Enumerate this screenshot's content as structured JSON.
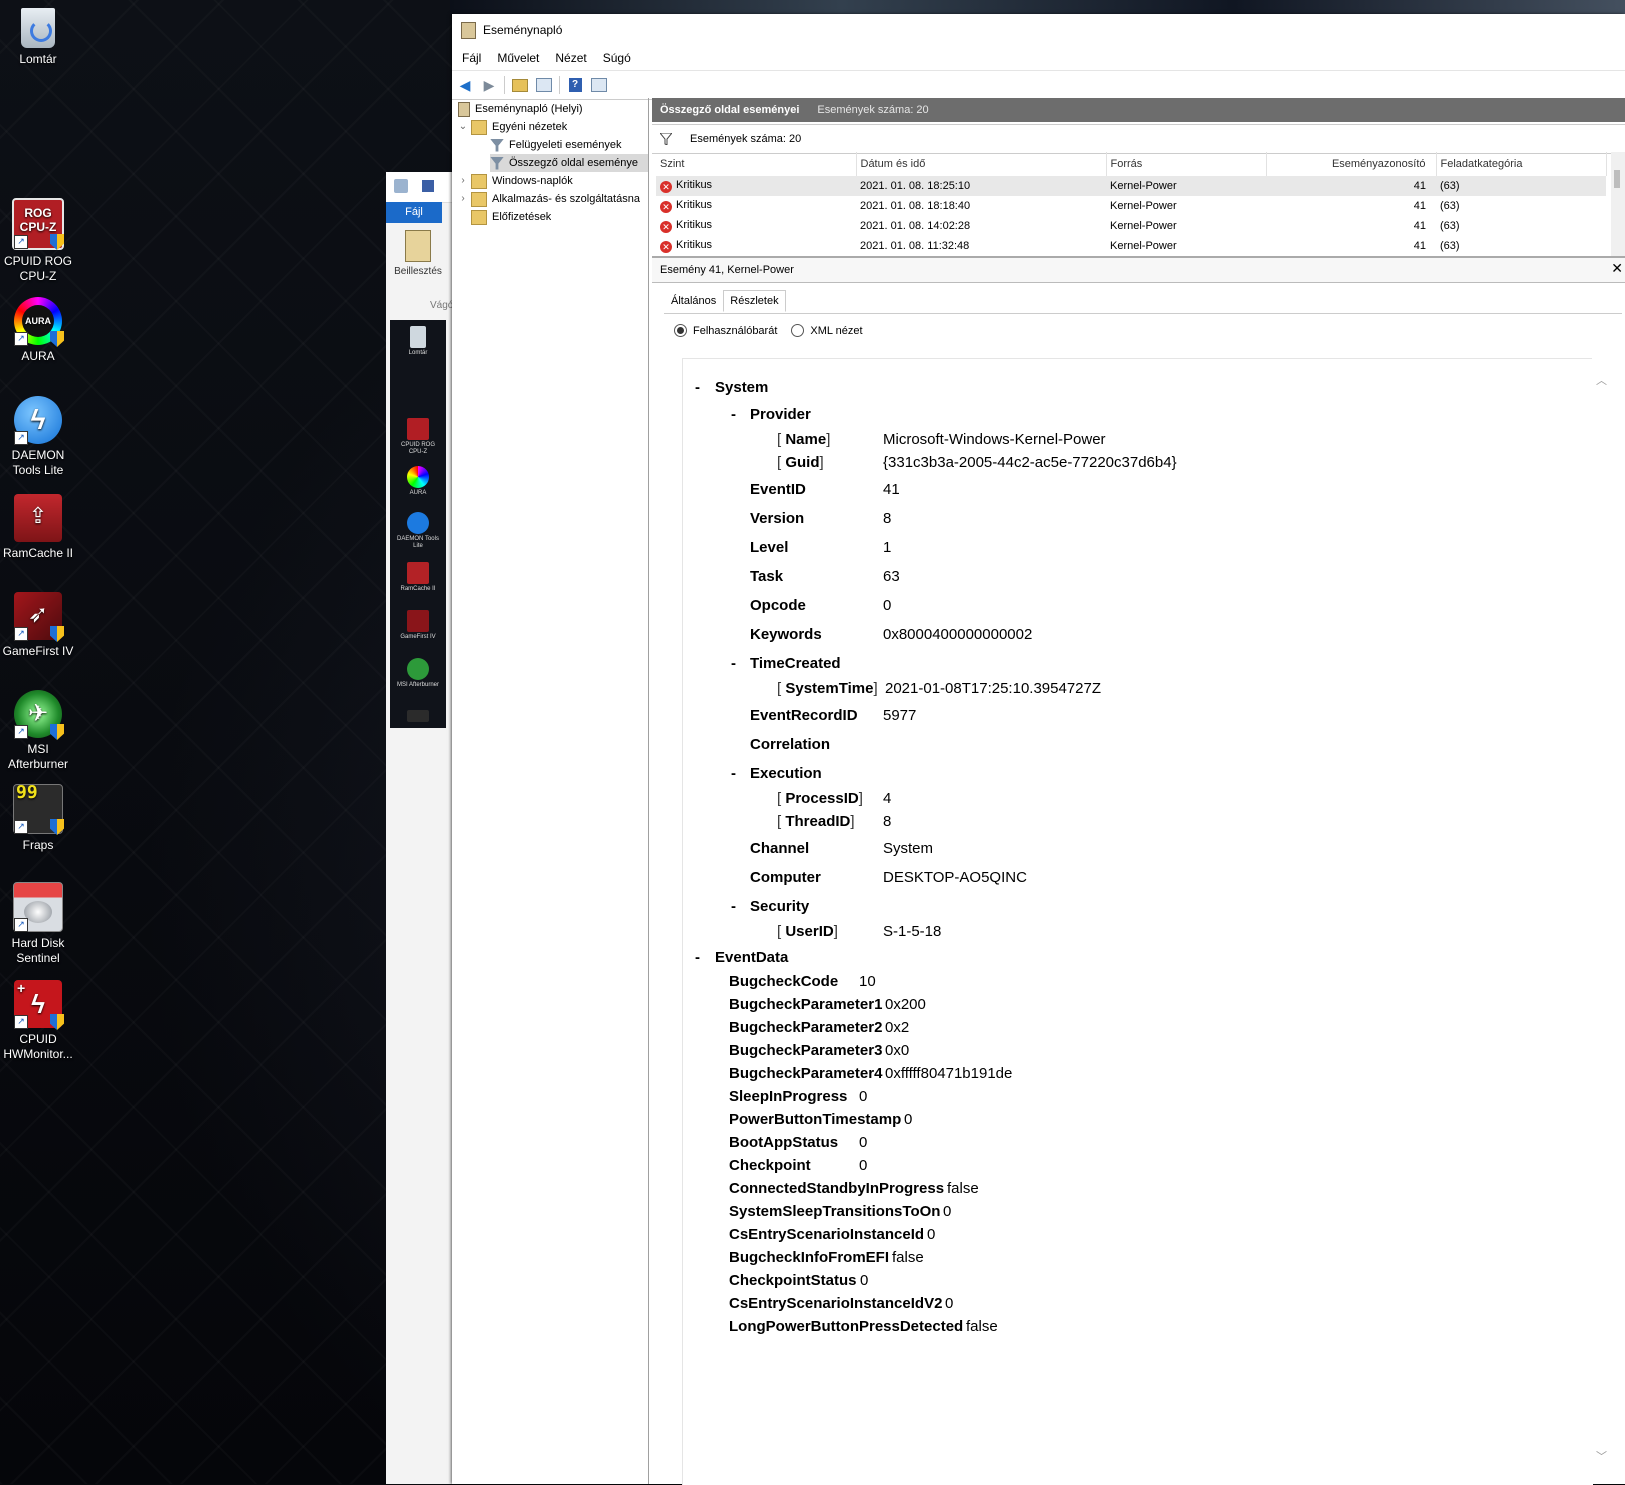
{
  "desktop": {
    "icons": [
      {
        "label": "Lomtár",
        "icon": "recycle-bin-icon"
      },
      {
        "label": "CPUID ROG CPU-Z",
        "icon": "rog-cpuz-icon"
      },
      {
        "label": "AURA",
        "icon": "aura-icon"
      },
      {
        "label": "DAEMON Tools Lite",
        "icon": "daemon-tools-icon"
      },
      {
        "label": "RamCache II",
        "icon": "ramcache-icon"
      },
      {
        "label": "GameFirst IV",
        "icon": "gamefirst-icon"
      },
      {
        "label": "MSI Afterburner",
        "icon": "msi-afterburner-icon"
      },
      {
        "label": "Fraps",
        "icon": "fraps-icon"
      },
      {
        "label": "Hard Disk Sentinel",
        "icon": "hard-disk-sentinel-icon"
      },
      {
        "label": "CPUID HWMonitor...",
        "icon": "hwmonitor-icon"
      }
    ]
  },
  "wordpad": {
    "tab_file": "Fájl",
    "paste_label": "Beillesztés",
    "group_label": "Vágó",
    "preview_icons": [
      "Lomtár",
      "CPUID ROG CPU-Z",
      "AURA",
      "DAEMON Tools Lite",
      "RamCache II",
      "GameFirst IV",
      "MSI Afterburner"
    ]
  },
  "window": {
    "title": "Eseménynapló",
    "menu": [
      "Fájl",
      "Művelet",
      "Nézet",
      "Súgó"
    ]
  },
  "tree": {
    "root": "Eseménynapló (Helyi)",
    "custom_views": "Egyéni nézetek",
    "admin_events": "Felügyeleti események",
    "summary_events": "Összegző oldal eseménye",
    "windows_logs": "Windows-naplók",
    "app_logs": "Alkalmazás- és szolgáltatásna",
    "subscriptions": "Előfizetések"
  },
  "list": {
    "header_title": "Összegző oldal eseményei",
    "header_count": "Események száma: 20",
    "filter_text": "Események száma: 20",
    "columns": [
      "Szint",
      "Dátum és idő",
      "Forrás",
      "Eseményazonosító",
      "Feladatkategória"
    ],
    "rows": [
      {
        "level": "Kritikus",
        "datetime": "2021. 01. 08. 18:25:10",
        "source": "Kernel-Power",
        "id": "41",
        "category": "(63)"
      },
      {
        "level": "Kritikus",
        "datetime": "2021. 01. 08. 18:18:40",
        "source": "Kernel-Power",
        "id": "41",
        "category": "(63)"
      },
      {
        "level": "Kritikus",
        "datetime": "2021. 01. 08. 14:02:28",
        "source": "Kernel-Power",
        "id": "41",
        "category": "(63)"
      },
      {
        "level": "Kritikus",
        "datetime": "2021. 01. 08. 11:32:48",
        "source": "Kernel-Power",
        "id": "41",
        "category": "(63)"
      }
    ]
  },
  "detail": {
    "title": "Esemény 41, Kernel-Power",
    "tabs": [
      "Általános",
      "Részletek"
    ],
    "radio_friendly": "Felhasználóbarát",
    "radio_xml": "XML nézet",
    "system": {
      "label": "System",
      "provider": "Provider",
      "name_key": "Name",
      "name_val": "Microsoft-Windows-Kernel-Power",
      "guid_key": "Guid",
      "guid_val": "{331c3b3a-2005-44c2-ac5e-77220c37d6b4}",
      "fields": [
        {
          "key": "EventID",
          "val": "41"
        },
        {
          "key": "Version",
          "val": "8"
        },
        {
          "key": "Level",
          "val": "1"
        },
        {
          "key": "Task",
          "val": "63"
        },
        {
          "key": "Opcode",
          "val": "0"
        },
        {
          "key": "Keywords",
          "val": "0x8000400000000002"
        }
      ],
      "timecreated": "TimeCreated",
      "systemtime_key": "SystemTime",
      "systemtime_val": "2021-01-08T17:25:10.3954727Z",
      "recordid_key": "EventRecordID",
      "recordid_val": "5977",
      "correlation": "Correlation",
      "execution": "Execution",
      "processid_key": "ProcessID",
      "processid_val": "4",
      "threadid_key": "ThreadID",
      "threadid_val": "8",
      "channel_key": "Channel",
      "channel_val": "System",
      "computer_key": "Computer",
      "computer_val": "DESKTOP-AO5QINC",
      "security": "Security",
      "userid_key": "UserID",
      "userid_val": "S-1-5-18"
    },
    "eventdata": {
      "label": "EventData",
      "fields": [
        {
          "key": "BugcheckCode",
          "val": "10"
        },
        {
          "key": "BugcheckParameter1",
          "val": "0x200"
        },
        {
          "key": "BugcheckParameter2",
          "val": "0x2"
        },
        {
          "key": "BugcheckParameter3",
          "val": "0x0"
        },
        {
          "key": "BugcheckParameter4",
          "val": "0xfffff80471b191de"
        },
        {
          "key": "SleepInProgress",
          "val": "0"
        },
        {
          "key": "PowerButtonTimestamp",
          "val": "0"
        },
        {
          "key": "BootAppStatus",
          "val": "0"
        },
        {
          "key": "Checkpoint",
          "val": "0"
        },
        {
          "key": "ConnectedStandbyInProgress",
          "val": "false"
        },
        {
          "key": "SystemSleepTransitionsToOn",
          "val": "0"
        },
        {
          "key": "CsEntryScenarioInstanceId",
          "val": "0"
        },
        {
          "key": "BugcheckInfoFromEFI",
          "val": "false"
        },
        {
          "key": "CheckpointStatus",
          "val": "0"
        },
        {
          "key": "CsEntryScenarioInstanceIdV2",
          "val": "0"
        },
        {
          "key": "LongPowerButtonPressDetected",
          "val": "false"
        }
      ]
    }
  },
  "colors": {
    "critical": "#d9302a",
    "header_bar": "#6d6d6d",
    "wordpad_accent": "#1b6ac9"
  }
}
